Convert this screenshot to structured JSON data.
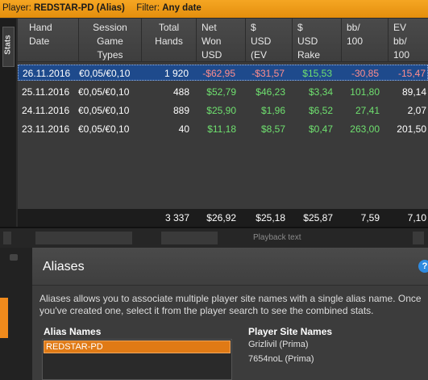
{
  "filter_bar": {
    "player_label": "Player:",
    "player_value": "REDSTAR-PD (Alias)",
    "filter_label": "Filter:",
    "filter_value": "Any date"
  },
  "side_tab": {
    "label": "Stats"
  },
  "table": {
    "columns": [
      "Hand\nDate",
      "Session\nGame\nTypes",
      "Total\nHands",
      "Net\nWon\nUSD",
      "$\nUSD\n(EV",
      "$\nUSD\nRake",
      "bb/\n100",
      "EV\nbb/\n100"
    ],
    "rows": [
      {
        "date": "26.11.2016",
        "stakes": "€0,05/€0,10",
        "hands": "1 920",
        "net": "-$62,95",
        "ev": "-$31,57",
        "rake": "$15,53",
        "bb100": "-30,85",
        "evbb100": "-15,47"
      },
      {
        "date": "25.11.2016",
        "stakes": "€0,05/€0,10",
        "hands": "488",
        "net": "$52,79",
        "ev": "$46,23",
        "rake": "$3,34",
        "bb100": "101,80",
        "evbb100": "89,14"
      },
      {
        "date": "24.11.2016",
        "stakes": "€0,05/€0,10",
        "hands": "889",
        "net": "$25,90",
        "ev": "$1,96",
        "rake": "$6,52",
        "bb100": "27,41",
        "evbb100": "2,07"
      },
      {
        "date": "23.11.2016",
        "stakes": "€0,05/€0,10",
        "hands": "40",
        "net": "$11,18",
        "ev": "$8,57",
        "rake": "$0,47",
        "bb100": "263,00",
        "evbb100": "201,50"
      }
    ],
    "totals": {
      "hands": "3 337",
      "net": "$26,92",
      "ev": "$25,18",
      "rake": "$25,87",
      "bb100": "7,59",
      "evbb100": "7,10"
    }
  },
  "strip": {
    "text": "Playback text"
  },
  "dialog": {
    "title": "Aliases",
    "description": "Aliases allows you to associate multiple player site names with a single alias name.  Once you've created one, select it from the player search to see the combined stats.",
    "alias_names_label": "Alias Names",
    "player_site_names_label": "Player Site Names",
    "aliases": [
      "REDSTAR-PD"
    ],
    "site_names": [
      "Grizlivil (Prima)",
      "7654noL (Prima)"
    ]
  },
  "colors": {
    "accent": "#f5a623",
    "positive": "#6fe06f",
    "negative": "#ff6a6a",
    "selection": "#1e4a8c"
  }
}
